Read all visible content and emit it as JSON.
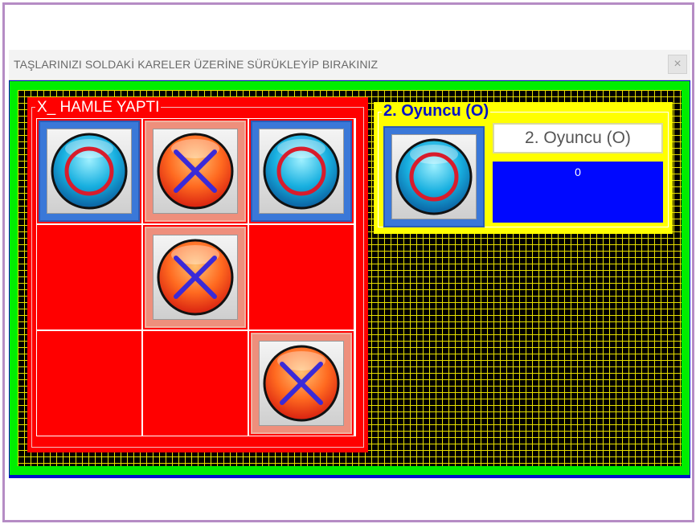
{
  "window": {
    "title": "TAŞLARINIZI SOLDAKİ KARELER ÜZERİNE SÜRÜKLEYİP BIRAKINIZ",
    "close_label": "×"
  },
  "board": {
    "status_label": "X_ HAMLE YAPTI",
    "cells": [
      [
        "O",
        "X",
        "O"
      ],
      [
        "",
        "X",
        ""
      ],
      [
        "",
        "",
        "X"
      ]
    ]
  },
  "player": {
    "group_title": "2. Oyuncu (O)",
    "name_value": "2. Oyuncu (O)",
    "score": "0",
    "piece": "O"
  },
  "colors": {
    "board_bg": "#ff0000",
    "panel_bg": "#ffff00",
    "score_bg": "#0008ff",
    "frame": "#00ee00",
    "grid_line": "#e8e000"
  }
}
